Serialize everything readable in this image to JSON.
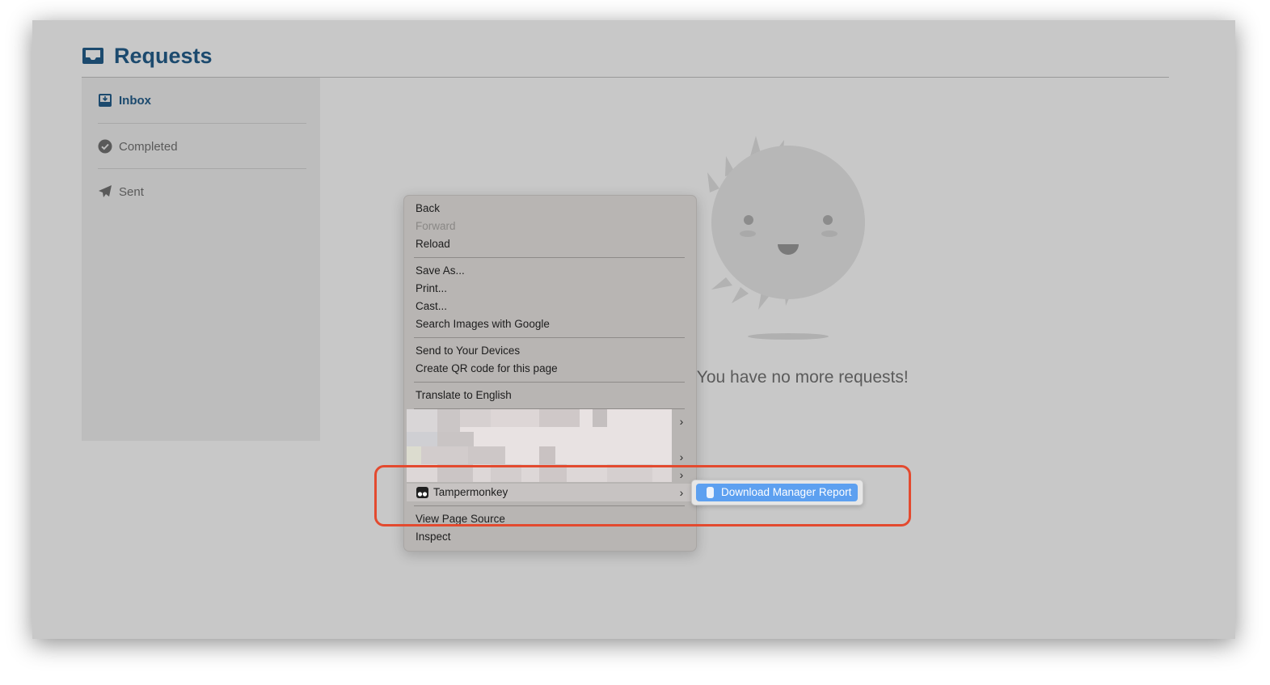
{
  "header": {
    "title": "Requests",
    "icon": "inbox-tray-icon",
    "title_color": "#1c4a6e"
  },
  "sidebar": {
    "items": [
      {
        "label": "Inbox",
        "icon": "inbox-icon",
        "active": true
      },
      {
        "label": "Completed",
        "icon": "check-circle-icon",
        "active": false
      },
      {
        "label": "Sent",
        "icon": "paper-plane-icon",
        "active": false
      }
    ]
  },
  "main": {
    "empty_message": "y! You have no more requests!",
    "illustration": "smiling-sun-icon"
  },
  "context_menu": {
    "back": "Back",
    "forward": "Forward",
    "reload": "Reload",
    "save_as": "Save As...",
    "print": "Print...",
    "cast": "Cast...",
    "search_images": "Search Images with Google",
    "send_to_devices": "Send to Your Devices",
    "create_qr": "Create QR code for this page",
    "translate": "Translate to English",
    "tampermonkey": "Tampermonkey",
    "view_source": "View Page Source",
    "inspect": "Inspect"
  },
  "submenu": {
    "item_label": "Download Manager Report",
    "highlight_color": "#5da0f0"
  },
  "annotation": {
    "color": "#e34a2f"
  }
}
